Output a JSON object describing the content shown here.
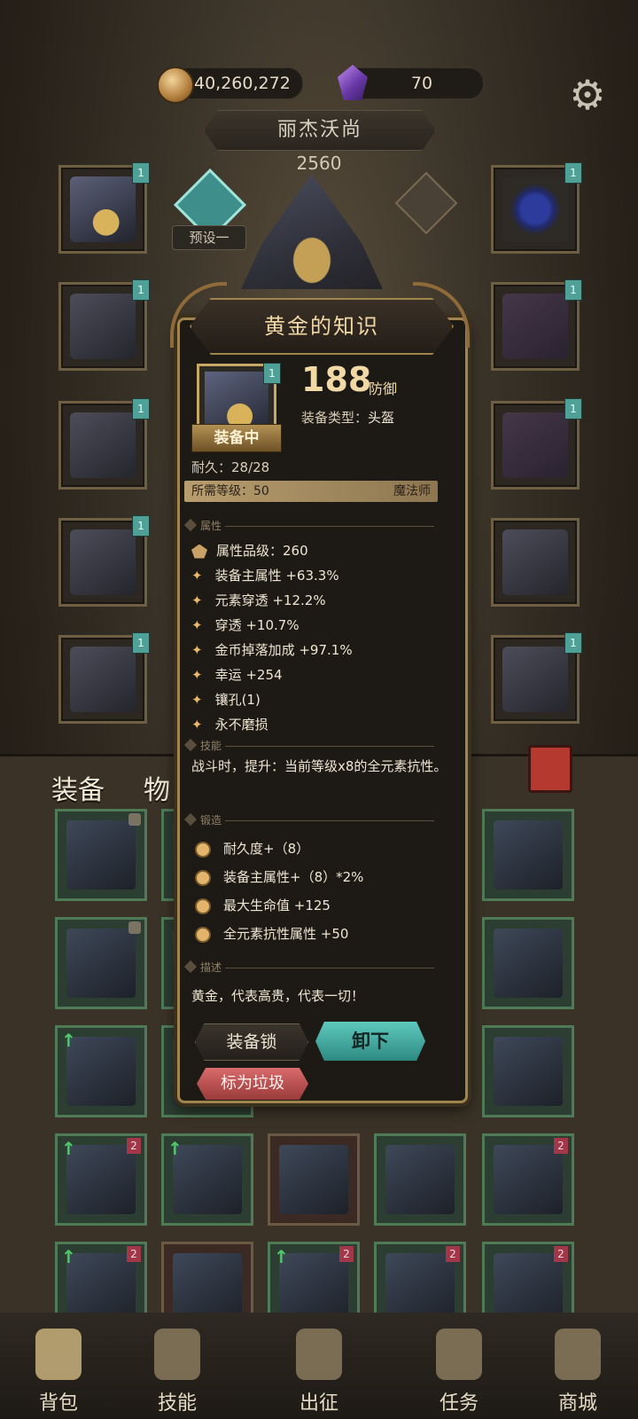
{
  "currency": {
    "gold": "40,260,272",
    "gems": "70"
  },
  "character": {
    "name": "丽杰沃尚",
    "power": "2560",
    "preset": "预设一"
  },
  "tabs": {
    "equipment": "装备",
    "items": "物"
  },
  "item": {
    "name": "黄金的知识",
    "stat_value": "188",
    "stat_unit": "防御",
    "type_label": "装备类型：",
    "type_value": "头盔",
    "equipped": "装备中",
    "durability": "耐久：28/28",
    "req_label": "所需等级：50",
    "req_class": "魔法师",
    "sections": {
      "attributes": "属性",
      "skill": "技能",
      "forge": "锻造",
      "description": "描述"
    },
    "quality": "属性品级：260",
    "attributes": [
      "装备主属性 +63.3%",
      "元素穿透 +12.2%",
      "穿透 +10.7%",
      "金币掉落加成 +97.1%",
      "幸运 +254",
      "镶孔(1)",
      "永不磨损"
    ],
    "skill": "战斗时，提升：当前等级x8的全元素抗性。",
    "forge": [
      "耐久度+（8）",
      "装备主属性+（8）*2%",
      "最大生命值 +125",
      "全元素抗性属性 +50"
    ],
    "description": "黄金，代表高贵，代表一切！",
    "buttons": {
      "lock": "装备锁",
      "unequip": "卸下",
      "junk": "标为垃圾"
    }
  },
  "slot_badge": "1",
  "tier_badge": "2",
  "bottom_nav": [
    {
      "label": "背包"
    },
    {
      "label": "技能"
    },
    {
      "label": "出征"
    },
    {
      "label": "任务"
    },
    {
      "label": "商城"
    }
  ]
}
